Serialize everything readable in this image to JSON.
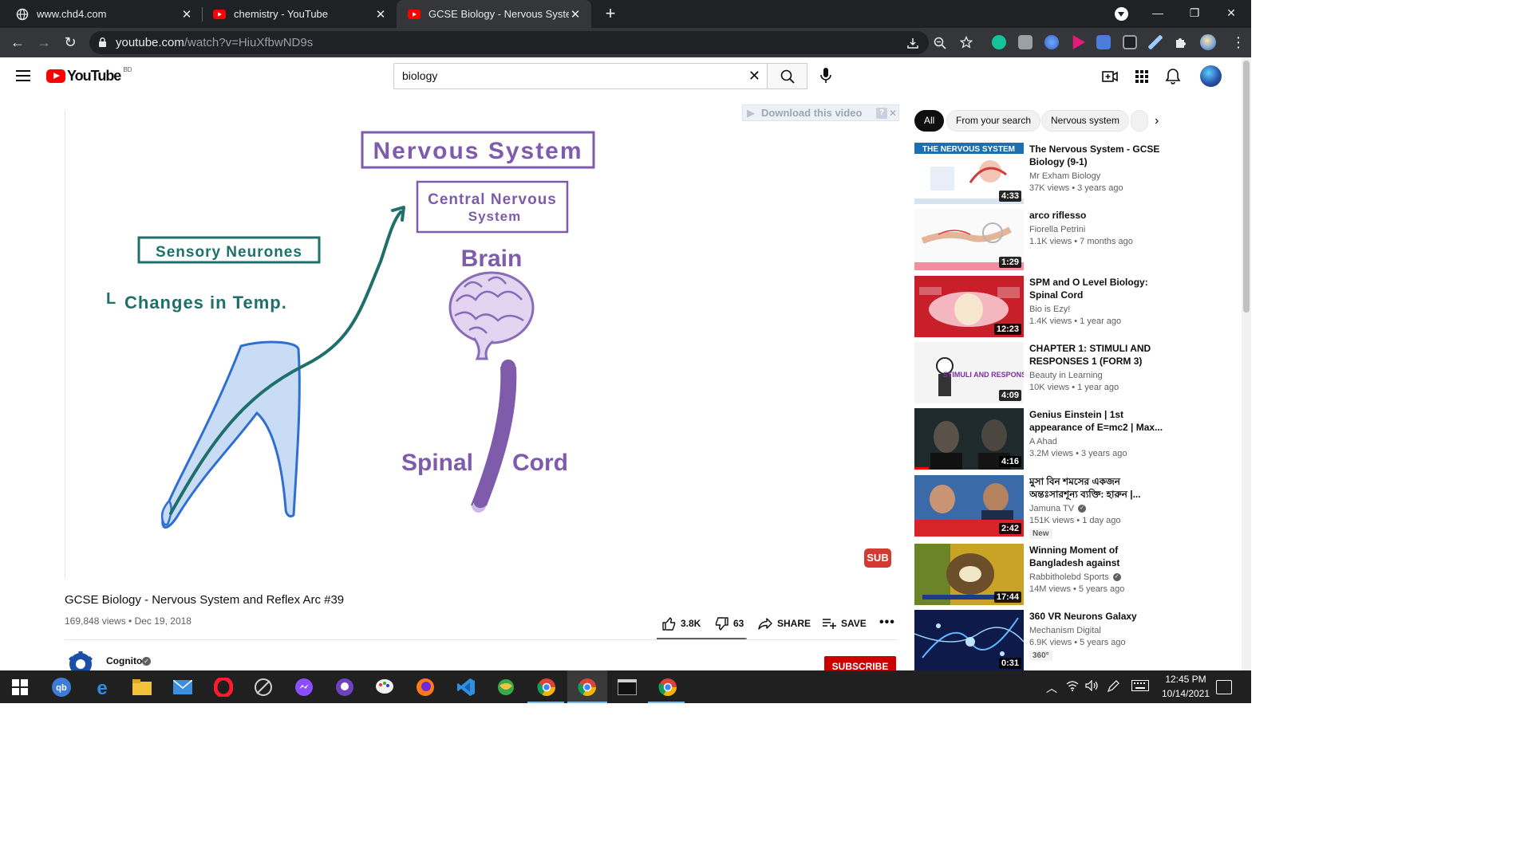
{
  "browser": {
    "tabs": [
      {
        "title": "www.chd4.com",
        "favicon": "globe-icon",
        "active": false
      },
      {
        "title": "chemistry - YouTube",
        "favicon": "youtube-icon",
        "active": false
      },
      {
        "title": "GCSE Biology - Nervous System a",
        "favicon": "youtube-icon",
        "active": true
      }
    ],
    "url_host": "youtube.com",
    "url_path": "/watch?v=HiuXfbwND9s"
  },
  "youtube": {
    "logo_text": "YouTube",
    "country": "BD",
    "search_value": "biology"
  },
  "player": {
    "download_banner": "Download this video",
    "download_help": "?",
    "sub_badge": "SUB",
    "slide": {
      "title": "Nervous System",
      "cns": [
        "Central Nervous",
        "System"
      ],
      "brain": "Brain",
      "spinal": "Spinal",
      "cord": "Cord",
      "sensory": "Sensory Neurones",
      "changes": "Changes in Temp.",
      "dash": "L"
    }
  },
  "video": {
    "title": "GCSE Biology - Nervous System and Reflex Arc #39",
    "views_date": "169,848 views • Dec 19, 2018",
    "likes": "3.8K",
    "dislikes": "63",
    "share": "SHARE",
    "save": "SAVE",
    "like_ratio": 0.98,
    "channel": "Cognito",
    "subscribe": "SUBSCRIBE"
  },
  "sidebar": {
    "chips": [
      "All",
      "From your search",
      "Nervous system"
    ],
    "recommendations": [
      {
        "title": "The Nervous System - GCSE Biology (9-1)",
        "channel": "Mr Exham Biology",
        "verified": false,
        "meta": "37K views • 3 years ago",
        "duration": "4:33",
        "badge": "",
        "thumb_text": "THE NERVOUS SYSTEM"
      },
      {
        "title": "arco riflesso",
        "channel": "Fiorella Petrini",
        "verified": false,
        "meta": "1.1K views • 7 months ago",
        "duration": "1:29",
        "badge": "",
        "thumb_text": ""
      },
      {
        "title": "SPM and O Level Biology: Spinal Cord",
        "channel": "Bio is Ezy!",
        "verified": false,
        "meta": "1.4K views • 1 year ago",
        "duration": "12:23",
        "badge": "",
        "thumb_text": ""
      },
      {
        "title": "CHAPTER 1: STIMULI AND RESPONSES 1 (FORM 3)",
        "channel": "Beauty in Learning",
        "verified": false,
        "meta": "10K views • 1 year ago",
        "duration": "4:09",
        "badge": "",
        "thumb_text": "STIMULI AND RESPONSES"
      },
      {
        "title": "Genius Einstein | 1st appearance of E=mc2 | Max...",
        "channel": "A Ahad",
        "verified": false,
        "meta": "3.2M views • 3 years ago",
        "duration": "4:16",
        "badge": "",
        "thumb_text": ""
      },
      {
        "title": "মুসা বিন শমসের একজন অন্তঃসারশূন্য ব্যক্তি: হারুন |...",
        "channel": "Jamuna TV",
        "verified": true,
        "meta": "151K views • 1 day ago",
        "duration": "2:42",
        "badge": "New",
        "thumb_text": ""
      },
      {
        "title": "Winning Moment of Bangladesh against Pakistan...",
        "channel": "Rabbitholebd Sports",
        "verified": true,
        "meta": "14M views • 5 years ago",
        "duration": "17:44",
        "badge": "",
        "thumb_text": ""
      },
      {
        "title": "360 VR Neurons Galaxy",
        "channel": "Mechanism Digital",
        "verified": false,
        "meta": "6.9K views • 5 years ago",
        "duration": "0:31",
        "badge": "360°",
        "thumb_text": ""
      }
    ]
  },
  "taskbar": {
    "time": "12:45 PM",
    "date": "10/14/2021"
  },
  "colors": {
    "youtube_red": "#ff0000",
    "slide_purple": "#7e5bab",
    "slide_teal": "#1f6f6a",
    "subscribe_red": "#cc0000"
  }
}
